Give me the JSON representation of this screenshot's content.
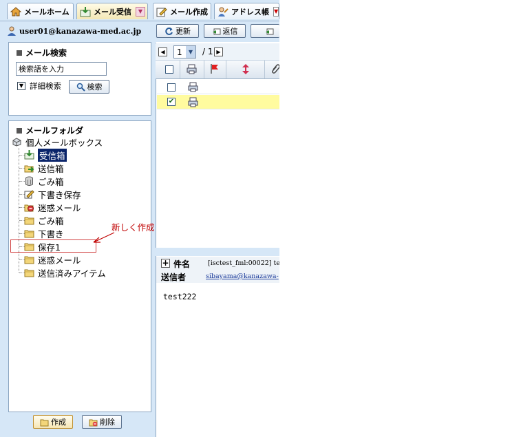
{
  "tabs": [
    {
      "label": "メールホーム",
      "icon": "home-icon"
    },
    {
      "label": "メール受信",
      "icon": "inbox-icon",
      "has_dropdown": true
    },
    {
      "label": "メール作成",
      "icon": "compose-icon"
    },
    {
      "label": "アドレス帳",
      "icon": "address-book-icon",
      "has_dropdown": true
    }
  ],
  "user": {
    "email": "user01@kanazawa-med.ac.jp"
  },
  "search": {
    "title": "メール検索",
    "value": "検索語を入力",
    "advanced_label": "詳細検索",
    "button_label": "検索"
  },
  "folders": {
    "title": "メールフォルダ",
    "root": "個人メールボックス",
    "items": [
      {
        "label": "受信箱",
        "icon": "inbox-folder-icon",
        "selected": true
      },
      {
        "label": "送信箱",
        "icon": "outbox-folder-icon"
      },
      {
        "label": "ごみ箱",
        "icon": "trash-can-icon"
      },
      {
        "label": "下書き保存",
        "icon": "draft-folder-icon"
      },
      {
        "label": "迷惑メール",
        "icon": "spam-folder-icon"
      },
      {
        "label": "ごみ箱",
        "icon": "folder-icon"
      },
      {
        "label": "下書き",
        "icon": "folder-icon"
      },
      {
        "label": "保存1",
        "icon": "folder-icon"
      },
      {
        "label": "迷惑メール",
        "icon": "folder-icon"
      },
      {
        "label": "送信済みアイテム",
        "icon": "folder-icon"
      }
    ]
  },
  "annotation": {
    "text": "新しく作成されたフォルダ",
    "color": "#c00000"
  },
  "folder_buttons": {
    "create": "作成",
    "delete": "削除"
  },
  "toolbar": {
    "refresh": "更新",
    "reply": "返信"
  },
  "pager": {
    "page": "1",
    "total": "/ 1"
  },
  "messages": [
    {
      "checked": false
    },
    {
      "checked": true,
      "highlight": "#fffb9f"
    }
  ],
  "preview": {
    "subject_label": "件名",
    "subject_value": "[isctest_fml:00022] te",
    "sender_label": "送信者",
    "sender_value": "sibayama@kanazawa-",
    "body": "test222"
  },
  "colors": {
    "pane_bg": "#d6e7f7",
    "selection": "#0a246a",
    "row_highlight": "#fffb9f"
  }
}
